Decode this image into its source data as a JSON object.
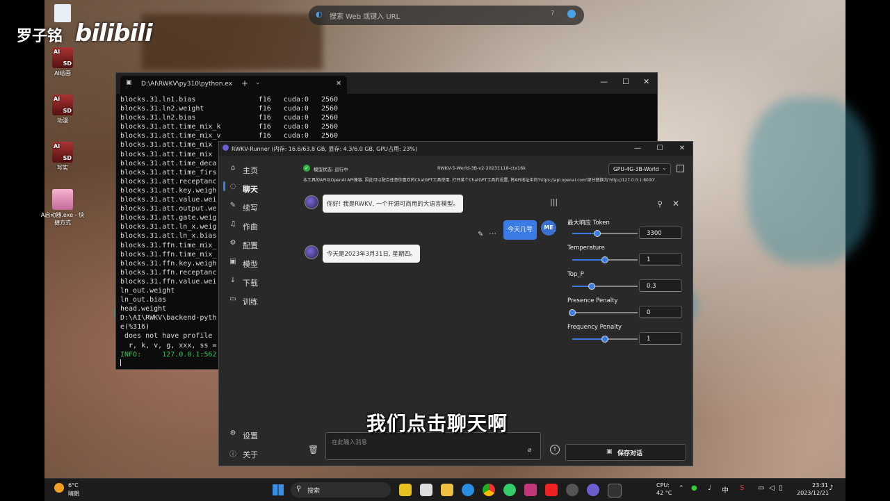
{
  "watermark": {
    "author": "罗子铭",
    "brand": "bilibili"
  },
  "desktop": {
    "icons": [
      {
        "label": "AI绘画",
        "badge_top": "AI",
        "badge_bottom": "SD"
      },
      {
        "label": "动漫",
        "badge_top": "AI",
        "badge_bottom": "SD"
      },
      {
        "label": "写实",
        "badge_top": "AI",
        "badge_bottom": "SD"
      },
      {
        "label": "A启动器.exe - 快捷方式"
      }
    ]
  },
  "browser_search": {
    "placeholder": "搜索 Web 或键入 URL"
  },
  "terminal": {
    "tab_title": "D:\\AI\\RWKV\\py310\\python.ex",
    "add_tab": "+",
    "lines": [
      "blocks.31.ln1.bias               f16   cuda:0   2560",
      "blocks.31.ln2.weight             f16   cuda:0   2560",
      "blocks.31.ln2.bias               f16   cuda:0   2560",
      "blocks.31.att.time_mix_k         f16   cuda:0   2560",
      "blocks.31.att.time_mix_v         f16   cuda:0   2560",
      "blocks.31.att.time_mix",
      "blocks.31.att.time_mix",
      "blocks.31.att.time_deca",
      "blocks.31.att.time_firs",
      "blocks.31.att.receptanc",
      "blocks.31.att.key.weigh",
      "blocks.31.att.value.wei",
      "blocks.31.att.output.we",
      "blocks.31.att.gate.weig",
      "blocks.31.att.ln_x.weig",
      "blocks.31.att.ln_x.bias",
      "blocks.31.ffn.time_mix_",
      "blocks.31.ffn.time_mix_",
      "blocks.31.ffn.key.weigh",
      "blocks.31.ffn.receptanc",
      "blocks.31.ffn.value.wei",
      "ln_out.weight",
      "ln_out.bias",
      "head.weight",
      "D:\\AI\\RWKV\\backend-pyth",
      "e(%316)",
      " does not have profile",
      "  r, k, v, g, xxx, ss =",
      "INFO:     127.0.0.1:562"
    ]
  },
  "runner": {
    "title": "RWKV-Runner (内存: 16.6/63.8 GB, 显存: 4.3/6.0 GB, GPU占用: 23%)",
    "nav": [
      {
        "label": "主页",
        "icon": "home-icon",
        "glyph": "⌂"
      },
      {
        "label": "聊天",
        "icon": "chat-icon",
        "glyph": "◌"
      },
      {
        "label": "续写",
        "icon": "write-icon",
        "glyph": "✎"
      },
      {
        "label": "作曲",
        "icon": "music-icon",
        "glyph": "♫"
      },
      {
        "label": "配置",
        "icon": "config-icon",
        "glyph": "⚙"
      },
      {
        "label": "模型",
        "icon": "model-icon",
        "glyph": "▣"
      },
      {
        "label": "下载",
        "icon": "download-icon",
        "glyph": "↓"
      },
      {
        "label": "训练",
        "icon": "train-icon",
        "glyph": "▭"
      }
    ],
    "nav_bottom": [
      {
        "label": "设置",
        "icon": "settings-icon",
        "glyph": "⚙"
      },
      {
        "label": "关于",
        "icon": "about-icon",
        "glyph": "ⓘ"
      }
    ],
    "status": "模型状态: 运行中",
    "model_name": "RWKV-5-World-3B-v2-20231118-ctx16k",
    "preset": "GPU-4G-3B-World",
    "api_notice": "本工具的API与OpenAI API兼容. 因此可以配合任意你喜欢的ChatGPT工具使用. 打开某个ChatGPT工具的设置, 将API地址中的'https://api.openai.com'部分替换为'http://127.0.0.1:8000'.",
    "messages": {
      "ai_greeting": "你好! 我是RWKV, 一个开源可商用的大语言模型。",
      "user": "今天几号",
      "user_avatar": "ME",
      "ai_reply": "今天是2023年3月31日, 星期四。"
    },
    "params": [
      {
        "label": "最大响应 Token",
        "value": "3300",
        "fraction": 0.38
      },
      {
        "label": "Temperature",
        "value": "1",
        "fraction": 0.5
      },
      {
        "label": "Top_P",
        "value": "0.3",
        "fraction": 0.3
      },
      {
        "label": "Presence Penalty",
        "value": "0",
        "fraction": 0.0
      },
      {
        "label": "Frequency Penalty",
        "value": "1",
        "fraction": 0.5
      }
    ],
    "input_placeholder": "在此输入消息",
    "save_button": "保存对话"
  },
  "subtitle": "我们点击聊天啊",
  "taskbar": {
    "weather_temp": "6°C",
    "weather_desc": "晴朗",
    "search_label": "搜索",
    "cpu_label": "CPU:",
    "cpu_temp": "42 °C",
    "ime": "中",
    "time": "23:31",
    "date": "2023/12/21"
  },
  "colors": {
    "accent": "#3b7be6",
    "status_ok": "#2fb344"
  }
}
